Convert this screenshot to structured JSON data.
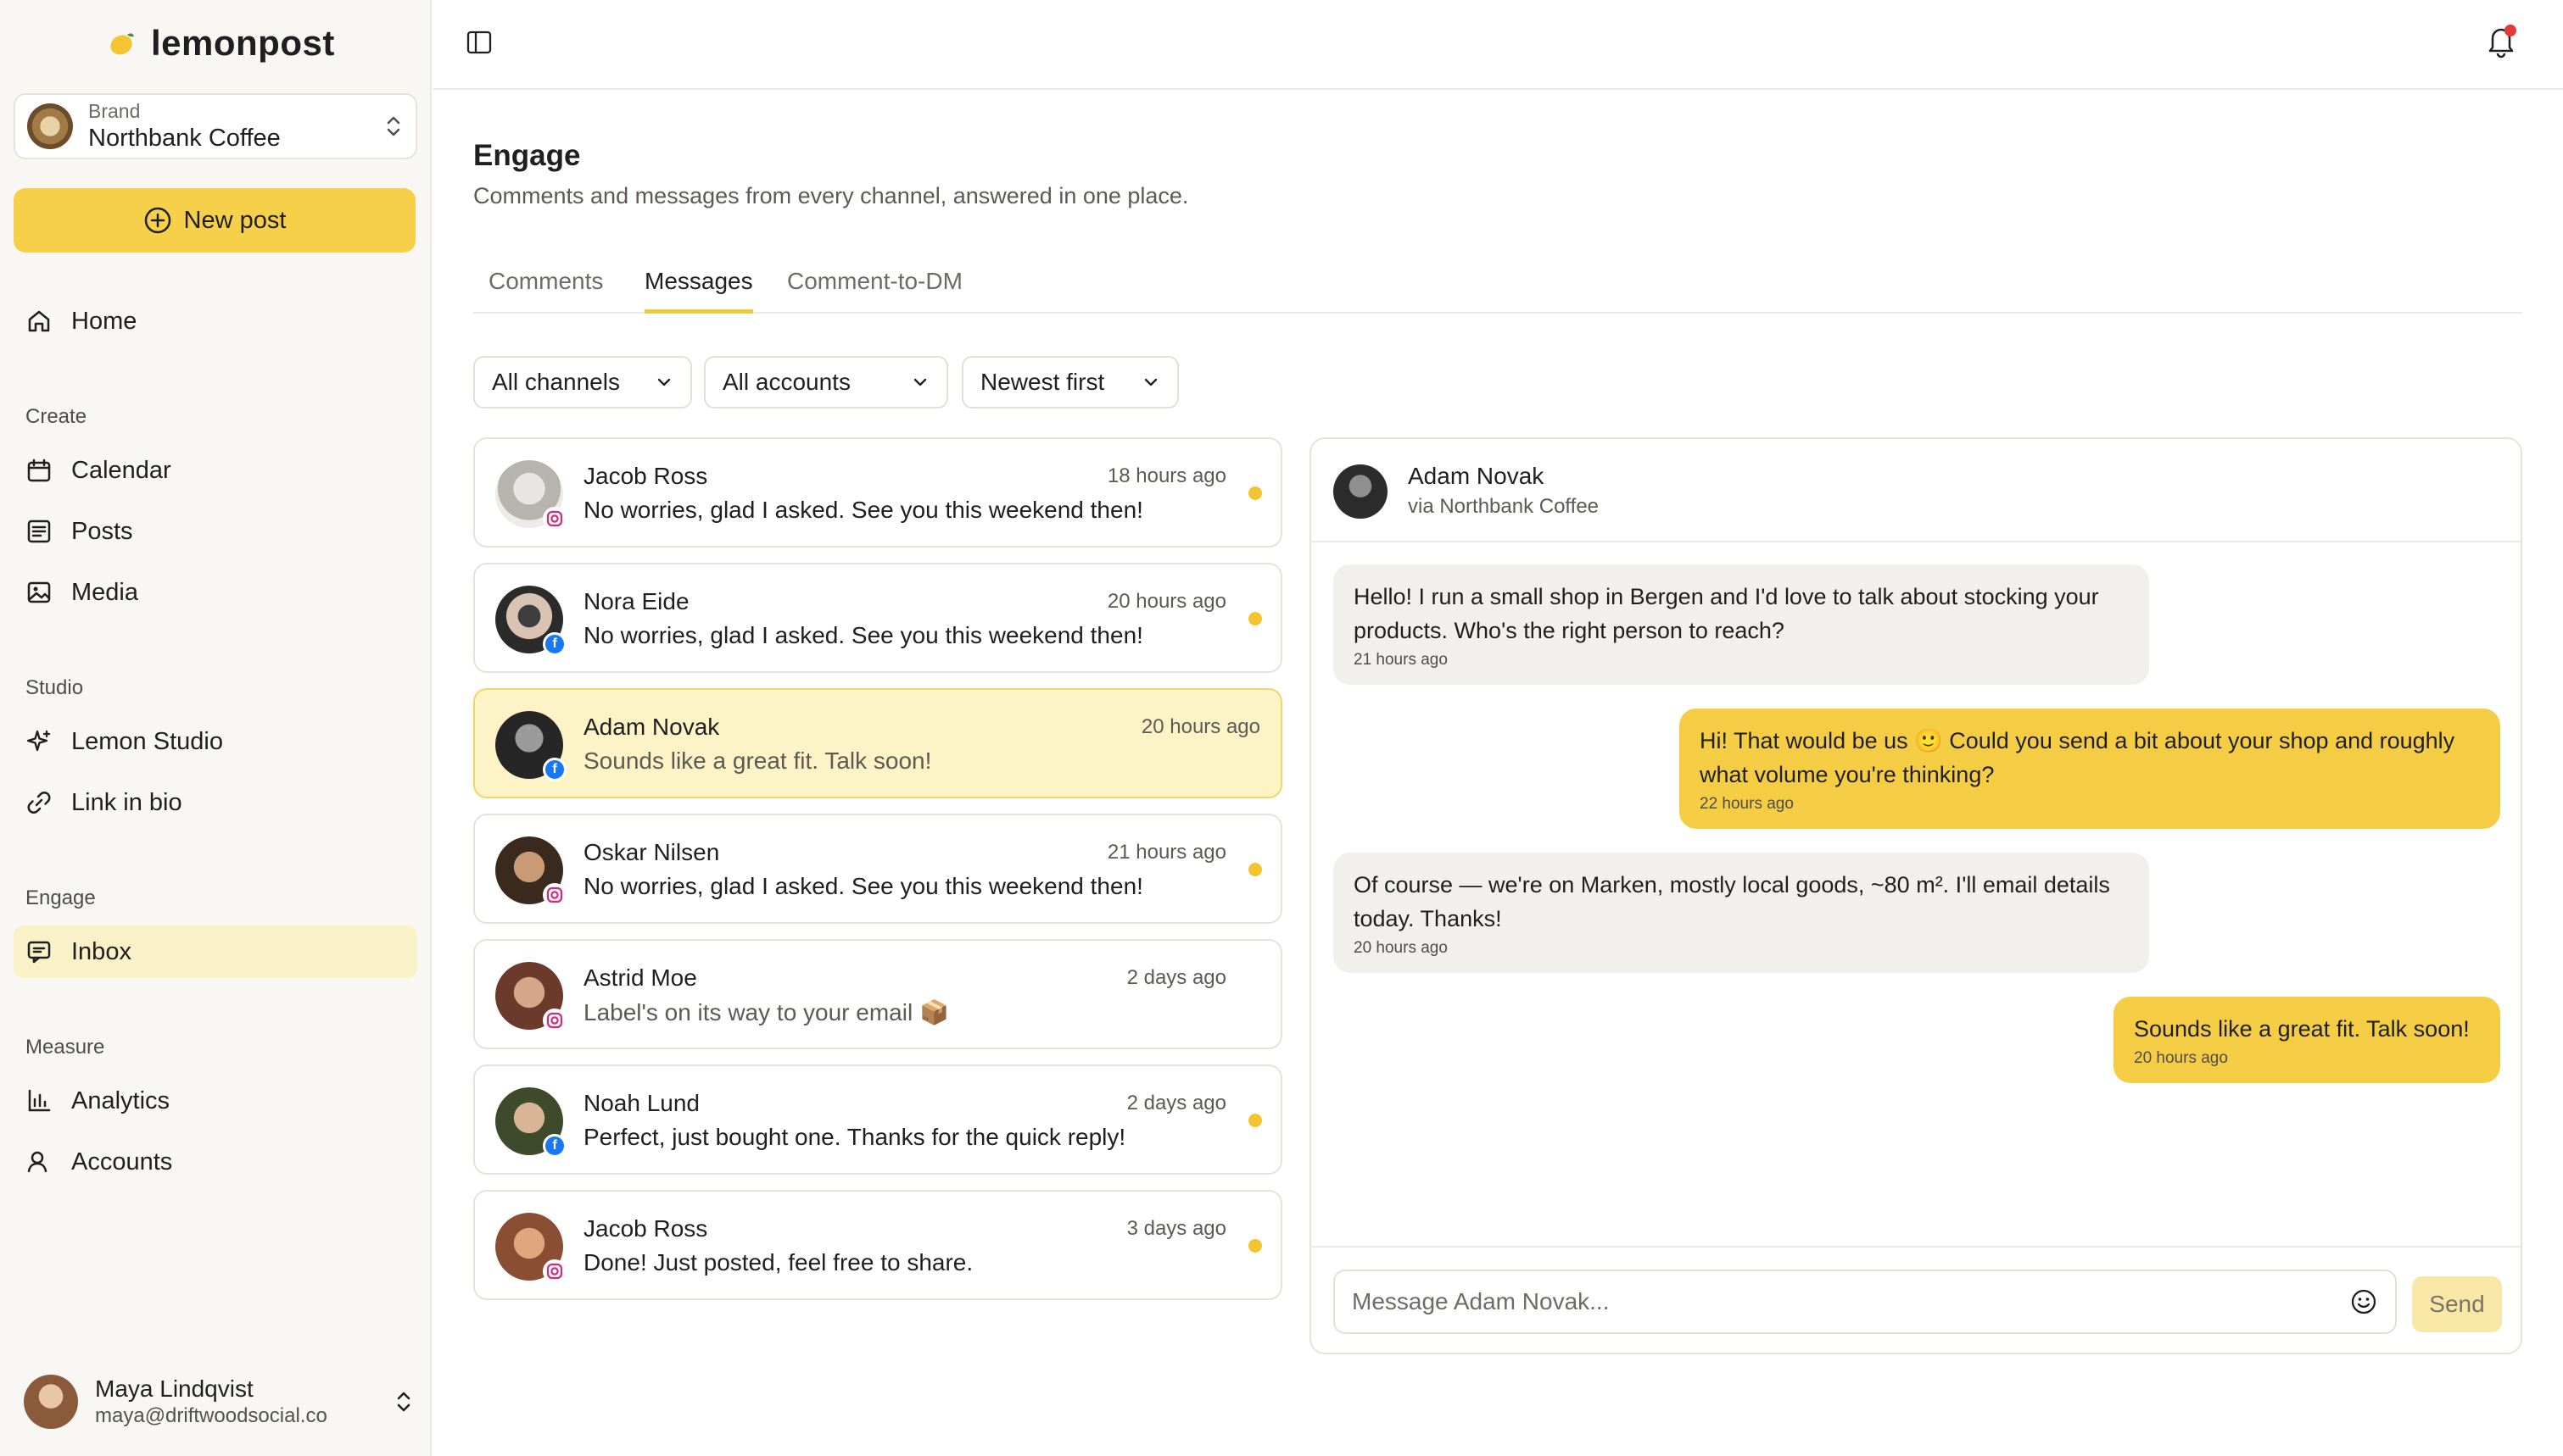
{
  "app": {
    "logo_text": "lemonpost"
  },
  "brand": {
    "label": "Brand",
    "name": "Northbank Coffee"
  },
  "new_post_label": "New post",
  "nav": {
    "home": "Home",
    "create_label": "Create",
    "calendar": "Calendar",
    "posts": "Posts",
    "media": "Media",
    "studio_label": "Studio",
    "lemon_studio": "Lemon Studio",
    "link_in_bio": "Link in bio",
    "engage_label": "Engage",
    "inbox": "Inbox",
    "measure_label": "Measure",
    "analytics": "Analytics",
    "accounts": "Accounts"
  },
  "user": {
    "name": "Maya Lindqvist",
    "email": "maya@driftwoodsocial.co"
  },
  "page": {
    "title": "Engage",
    "subtitle": "Comments and messages from every channel, answered in one place."
  },
  "tabs": [
    "Comments",
    "Messages",
    "Comment-to-DM"
  ],
  "active_tab": "Messages",
  "filters": {
    "channels": "All channels",
    "accounts": "All accounts",
    "sort": "Newest first"
  },
  "conversations": [
    {
      "name": "Jacob Ross",
      "time": "18 hours ago",
      "message": "No worries, glad I asked. See you this weekend then!",
      "channel": "instagram",
      "unread": true
    },
    {
      "name": "Nora Eide",
      "time": "20 hours ago",
      "message": "No worries, glad I asked. See you this weekend then!",
      "channel": "facebook",
      "unread": true
    },
    {
      "name": "Adam Novak",
      "time": "20 hours ago",
      "message": "Sounds like a great fit. Talk soon!",
      "channel": "facebook",
      "unread": false,
      "selected": true
    },
    {
      "name": "Oskar Nilsen",
      "time": "21 hours ago",
      "message": "No worries, glad I asked. See you this weekend then!",
      "channel": "instagram",
      "unread": true
    },
    {
      "name": "Astrid Moe",
      "time": "2 days ago",
      "message": "Label's on its way to your email 📦",
      "channel": "instagram",
      "unread": false
    },
    {
      "name": "Noah Lund",
      "time": "2 days ago",
      "message": "Perfect, just bought one. Thanks for the quick reply!",
      "channel": "facebook",
      "unread": true
    },
    {
      "name": "Jacob Ross",
      "time": "3 days ago",
      "message": "Done! Just posted, feel free to share.",
      "channel": "instagram",
      "unread": true
    }
  ],
  "chat": {
    "name": "Adam Novak",
    "via": "via Northbank Coffee",
    "messages": [
      {
        "direction": "in",
        "text": "Hello! I run a small shop in Bergen and I'd love to talk about stocking your products. Who's the right person to reach?",
        "time": "21 hours ago"
      },
      {
        "direction": "out",
        "text": "Hi! That would be us 🙂 Could you send a bit about your shop and roughly what volume you're thinking?",
        "time": "22 hours ago"
      },
      {
        "direction": "in",
        "text": "Of course — we're on Marken, mostly local goods, ~80 m². I'll email details today. Thanks!",
        "time": "20 hours ago"
      },
      {
        "direction": "out",
        "text": "Sounds like a great fit. Talk soon!",
        "time": "20 hours ago"
      }
    ],
    "composer_placeholder": "Message Adam Novak...",
    "send_label": "Send"
  },
  "colors": {
    "accent": "#f5cd45",
    "selected_bg": "#fcf4c6",
    "notification_dot": "#e53935",
    "facebook": "#1877f2"
  }
}
